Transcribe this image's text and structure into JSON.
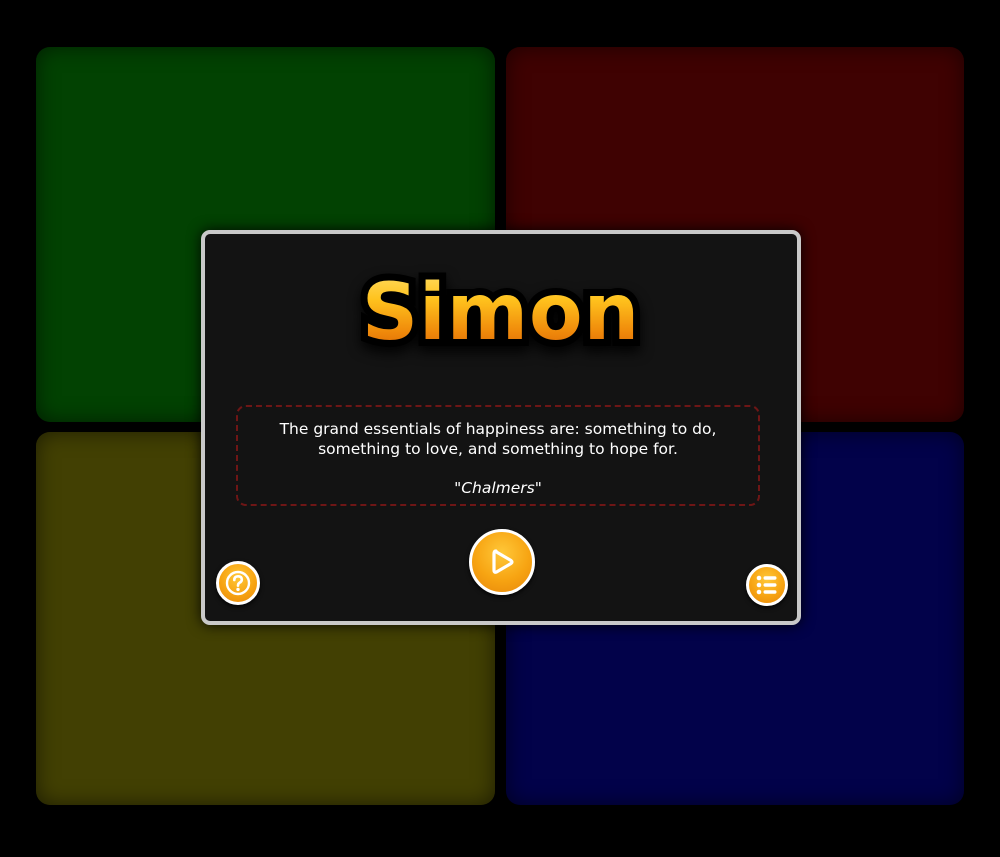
{
  "pads": [
    {
      "id": "green",
      "color": "#024202"
    },
    {
      "id": "red",
      "color": "#3f0202"
    },
    {
      "id": "yellow",
      "color": "#424003"
    },
    {
      "id": "blue",
      "color": "#02024a"
    }
  ],
  "dialog": {
    "title": "Simon",
    "quote": "The grand essentials of happiness are: something to do, something to love, and something to hope for.",
    "author": "\"Chalmers\"",
    "buttons": {
      "play": {
        "icon": "play-icon"
      },
      "help": {
        "icon": "question-icon"
      },
      "menu": {
        "icon": "list-icon"
      }
    },
    "colors": {
      "accent": "#f7a412",
      "border": "#c9c9c9",
      "quote_border": "#6e1616"
    }
  }
}
